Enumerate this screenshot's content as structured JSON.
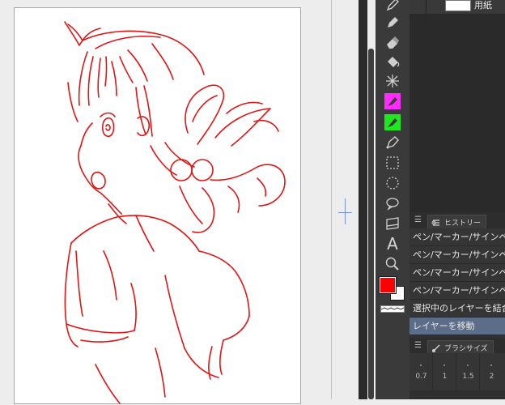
{
  "layer_panel": {
    "layer_name": "用紙"
  },
  "history_panel": {
    "tab_label": "ヒストリー",
    "items": [
      {
        "label": "ペン/マーカー/サインペン"
      },
      {
        "label": "ペン/マーカー/サインペン"
      },
      {
        "label": "ペン/マーカー/サインペン"
      },
      {
        "label": "ペン/マーカー/サインペン"
      },
      {
        "label": "選択中のレイヤーを結合"
      },
      {
        "label": "レイヤーを移動"
      }
    ]
  },
  "brush_size_panel": {
    "tab_label": "ブラシサイズ",
    "sizes": [
      "0.7",
      "1",
      "1.5",
      "2"
    ]
  },
  "toolbar": {
    "tools": [
      "pen-tool-icon",
      "pen-nib-icon",
      "eraser-icon",
      "fill-icon",
      "auto-select-icon",
      "color-select-magenta-icon",
      "color-select-green-icon",
      "pen-vector-icon",
      "rectangle-select-icon",
      "lasso-select-icon",
      "speech-bubble-icon",
      "gradient-icon",
      "text-icon",
      "zoom-icon"
    ],
    "text_tool_glyph": "A"
  },
  "colors": {
    "main_color": "#ff0000",
    "sub_color": "#ffffff",
    "line_color": "#e01515",
    "selected_history": "#5b6d88"
  }
}
